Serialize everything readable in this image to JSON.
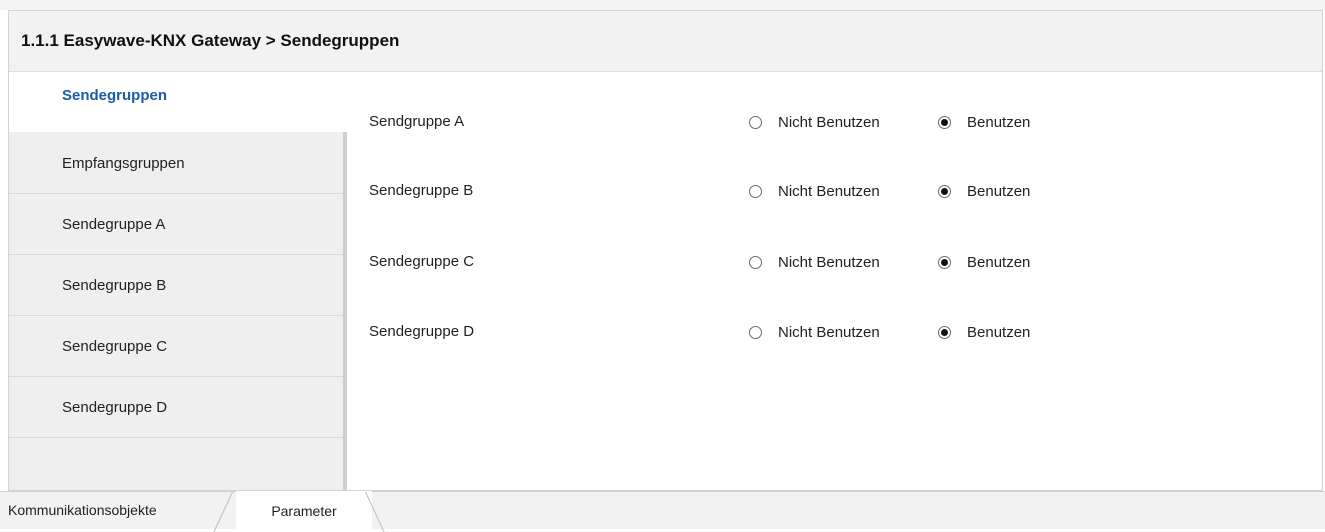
{
  "header": {
    "title": "1.1.1 Easywave-KNX Gateway > Sendegruppen"
  },
  "sidebar": {
    "items": [
      {
        "label": "Sendegruppen",
        "active": true
      },
      {
        "label": "Empfangsgruppen",
        "active": false
      },
      {
        "label": "Sendegruppe A",
        "active": false
      },
      {
        "label": "Sendegruppe B",
        "active": false
      },
      {
        "label": "Sendegruppe C",
        "active": false
      },
      {
        "label": "Sendegruppe D",
        "active": false
      }
    ]
  },
  "parameters": {
    "option_not_use": "Nicht Benutzen",
    "option_use": "Benutzen",
    "rows": [
      {
        "label": "Sendgruppe A",
        "selected": "Benutzen"
      },
      {
        "label": "Sendegruppe B",
        "selected": "Benutzen"
      },
      {
        "label": "Sendegruppe C",
        "selected": "Benutzen"
      },
      {
        "label": "Sendegruppe D",
        "selected": "Benutzen"
      }
    ]
  },
  "tabs": [
    {
      "label": "Kommunikationsobjekte",
      "active": false
    },
    {
      "label": "Parameter",
      "active": true
    }
  ],
  "colors": {
    "active_link": "#1e5ca8",
    "sidebar_bg": "#efefef",
    "header_bg": "#f2f2f2"
  }
}
